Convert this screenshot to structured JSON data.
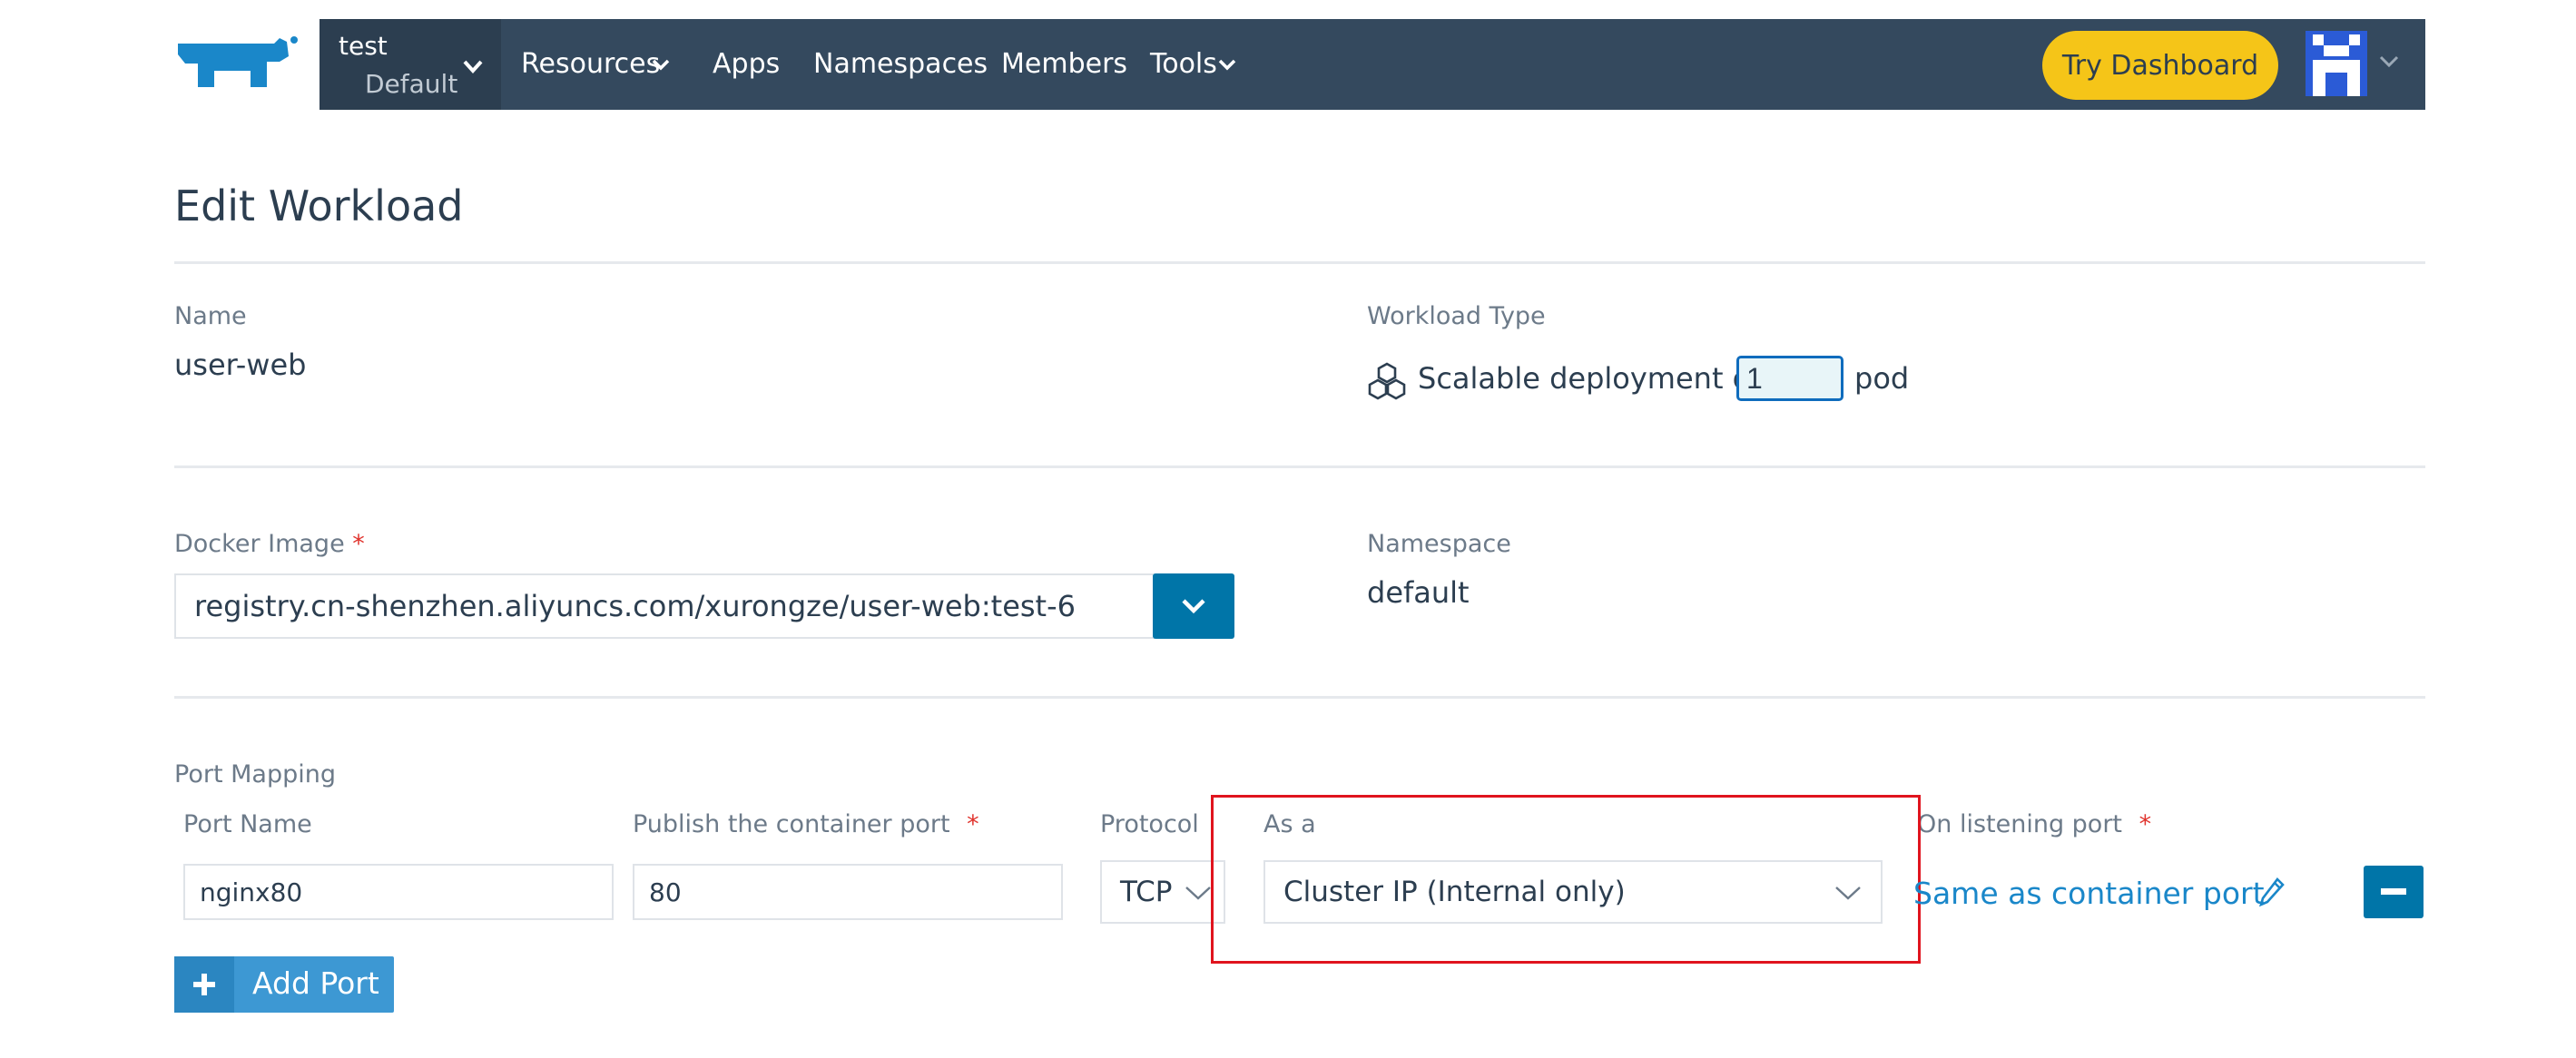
{
  "nav": {
    "cluster": "test",
    "project": "Default",
    "items": [
      "Resources",
      "Apps",
      "Namespaces",
      "Members",
      "Tools"
    ],
    "try_dashboard": "Try Dashboard"
  },
  "page": {
    "title": "Edit Workload"
  },
  "name_field": {
    "label": "Name",
    "value": "user-web"
  },
  "workload_type": {
    "label": "Workload Type",
    "prefix": "Scalable deployment of",
    "scale": "1",
    "suffix": "pod"
  },
  "docker_image": {
    "label": "Docker Image",
    "required_mark": "*",
    "value": "registry.cn-shenzhen.aliyuncs.com/xurongze/user-web:test-6"
  },
  "namespace": {
    "label": "Namespace",
    "value": "default"
  },
  "port_mapping": {
    "label": "Port Mapping",
    "col_port_name": "Port Name",
    "col_publish": "Publish the container port",
    "col_protocol": "Protocol",
    "col_as_a": "As a",
    "col_listening": "On listening port",
    "required_mark": "*",
    "row": {
      "port_name": "nginx80",
      "container_port": "80",
      "protocol": "TCP",
      "as_a": "Cluster IP (Internal only)",
      "listening": "Same as container port"
    },
    "add_port": "Add Port"
  },
  "colors": {
    "nav_bg": "#34495e",
    "accent_blue": "#0075a8",
    "try_dashboard_bg": "#f5c518",
    "highlight_red": "#e0141e"
  }
}
